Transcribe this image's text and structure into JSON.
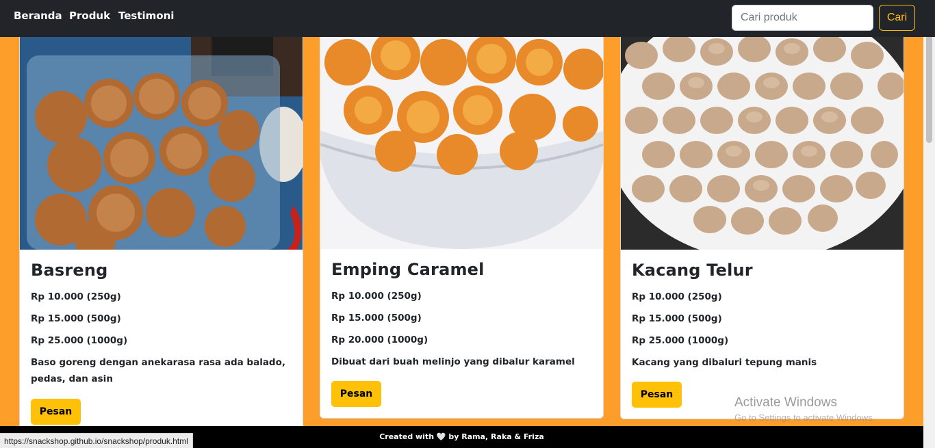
{
  "nav": {
    "links": [
      "Beranda",
      "Produk",
      "Testimoni"
    ],
    "search_placeholder": "Cari produk",
    "search_button": "Cari"
  },
  "products": [
    {
      "name": "Basreng",
      "prices": [
        "Rp 10.000 (250g)",
        "Rp 15.000 (500g)",
        "Rp 25.000 (1000g)"
      ],
      "description": "Baso goreng dengan anekarasa rasa ada balado, pedas, dan asin",
      "button": "Pesan"
    },
    {
      "name": "Emping Caramel",
      "prices": [
        "Rp 10.000 (250g)",
        "Rp 15.000 (500g)",
        "Rp 20.000 (1000g)"
      ],
      "description": "Dibuat dari buah melinjo yang dibalur karamel",
      "button": "Pesan"
    },
    {
      "name": "Kacang Telur",
      "prices": [
        "Rp 10.000 (250g)",
        "Rp 15.000 (500g)",
        "Rp 25.000 (1000g)"
      ],
      "description": "Kacang yang dibaluri tepung manis",
      "button": "Pesan"
    }
  ],
  "footer": {
    "text": "Created with 🤍 by Rama, Raka & Friza"
  },
  "status_bar": {
    "url": "https://snackshop.github.io/snackshop/produk.html"
  },
  "watermark": {
    "title": "Activate Windows",
    "subtitle": "Go to Settings to activate Windows."
  },
  "colors": {
    "background": "#FD9E2B",
    "navbar": "#212529",
    "accent": "#FFC107"
  }
}
